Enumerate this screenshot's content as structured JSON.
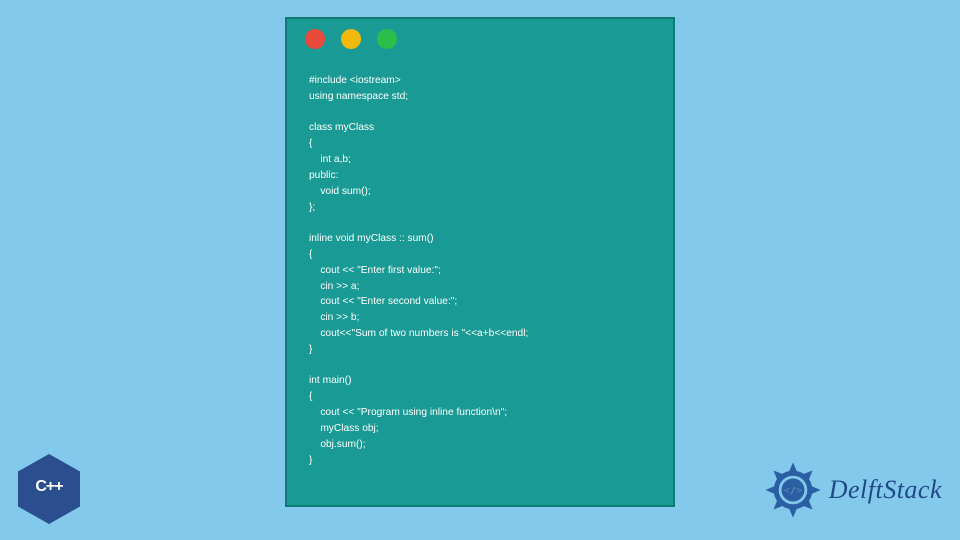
{
  "window": {
    "dots": [
      "#e84b3c",
      "#f2b90c",
      "#2dbd4a"
    ],
    "code": "#include <iostream>\nusing namespace std;\n\nclass myClass\n{\n    int a,b;\npublic:\n    void sum();\n};\n\ninline void myClass :: sum()\n{\n    cout << \"Enter first value:\";\n    cin >> a;\n    cout << \"Enter second value:\";\n    cin >> b;\n    cout<<\"Sum of two numbers is \"<<a+b<<endl;\n}\n\nint main()\n{\n    cout << \"Program using inline function\\n\";\n    myClass obj;\n    obj.sum();\n}"
  },
  "cpp_badge": {
    "label": "C++"
  },
  "brand": {
    "name": "DelftStack"
  }
}
